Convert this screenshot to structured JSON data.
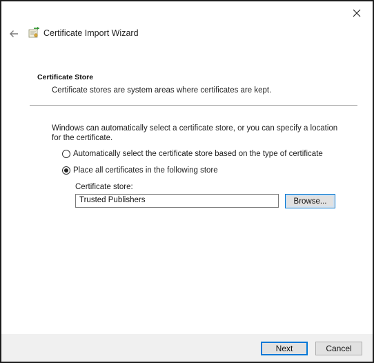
{
  "window": {
    "title": "Certificate Import Wizard",
    "close_icon": "close-icon",
    "back_icon": "back-arrow-icon",
    "wizard_icon": "certificate-icon"
  },
  "section": {
    "title": "Certificate Store",
    "description": "Certificate stores are system areas where certificates are kept."
  },
  "intro_text": "Windows can automatically select a certificate store, or you can specify a location for the certificate.",
  "options": [
    {
      "label": "Automatically select the certificate store based on the type of certificate",
      "selected": false
    },
    {
      "label": "Place all certificates in the following store",
      "selected": true
    }
  ],
  "store": {
    "label": "Certificate store:",
    "value": "Trusted Publishers",
    "browse_label": "Browse..."
  },
  "footer": {
    "next_label": "Next",
    "cancel_label": "Cancel"
  },
  "colors": {
    "accent": "#0078d7",
    "footer_bg": "#f0f0f0",
    "button_bg": "#e1e1e1"
  }
}
